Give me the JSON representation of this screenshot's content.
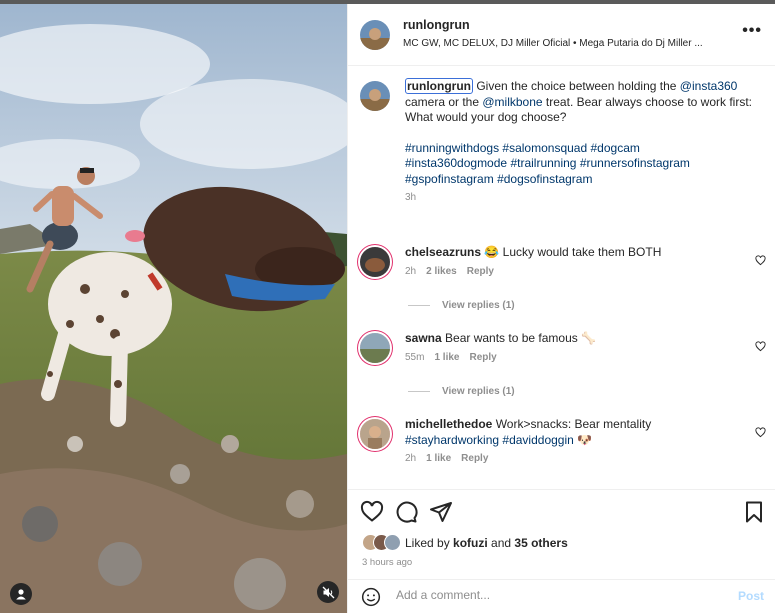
{
  "post": {
    "username": "runlongrun",
    "audio": "MC GW, MC DELUX, DJ Miller Oficial • Mega Putaria do Dj Miller ...",
    "more_icon": "more-horizontal-icon"
  },
  "caption": {
    "username": "runlongrun",
    "text_1": " Given the choice between holding the ",
    "mention_1": "@insta360",
    "text_2": " camera or the ",
    "mention_2": "@milkbone",
    "text_3": " treat. Bear always choose to work first:",
    "text_4": "What would your dog choose?",
    "hashtags": [
      "#runningwithdogs",
      "#salomonsquad",
      "#dogcam",
      "#insta360dogmode",
      "#trailrunning",
      "#runnersofinstagram",
      "#gspofinstagram",
      "#dogsofinstagram"
    ],
    "time": "3h"
  },
  "comments": [
    {
      "username": "chelseazruns",
      "text": " 😂 Lucky would take them BOTH",
      "time": "2h",
      "likes": "2 likes",
      "reply": "Reply",
      "view_replies": "View replies (1)"
    },
    {
      "username": "sawna",
      "text": " Bear wants to be famous 🦴",
      "time": "55m",
      "likes": "1 like",
      "reply": "Reply",
      "view_replies": "View replies (1)"
    },
    {
      "username": "michellethedoe",
      "text": " Work>snacks: Bear mentality ",
      "hashtag_1": "#stayhardworking",
      "hashtag_2": "#daviddoggin",
      "emoji": " 🐶",
      "time": "2h",
      "likes": "1 like",
      "reply": "Reply"
    }
  ],
  "likes": {
    "prefix": "Liked by ",
    "user": "kofuzi",
    "middle": " and ",
    "others": "35 others"
  },
  "time_ago": "3 hours ago",
  "add_comment": {
    "placeholder": "Add a comment...",
    "post_label": "Post"
  },
  "colors": {
    "link": "#00376b",
    "secondary_text": "#8e8e8e",
    "post_disabled": "#b3dbff"
  }
}
